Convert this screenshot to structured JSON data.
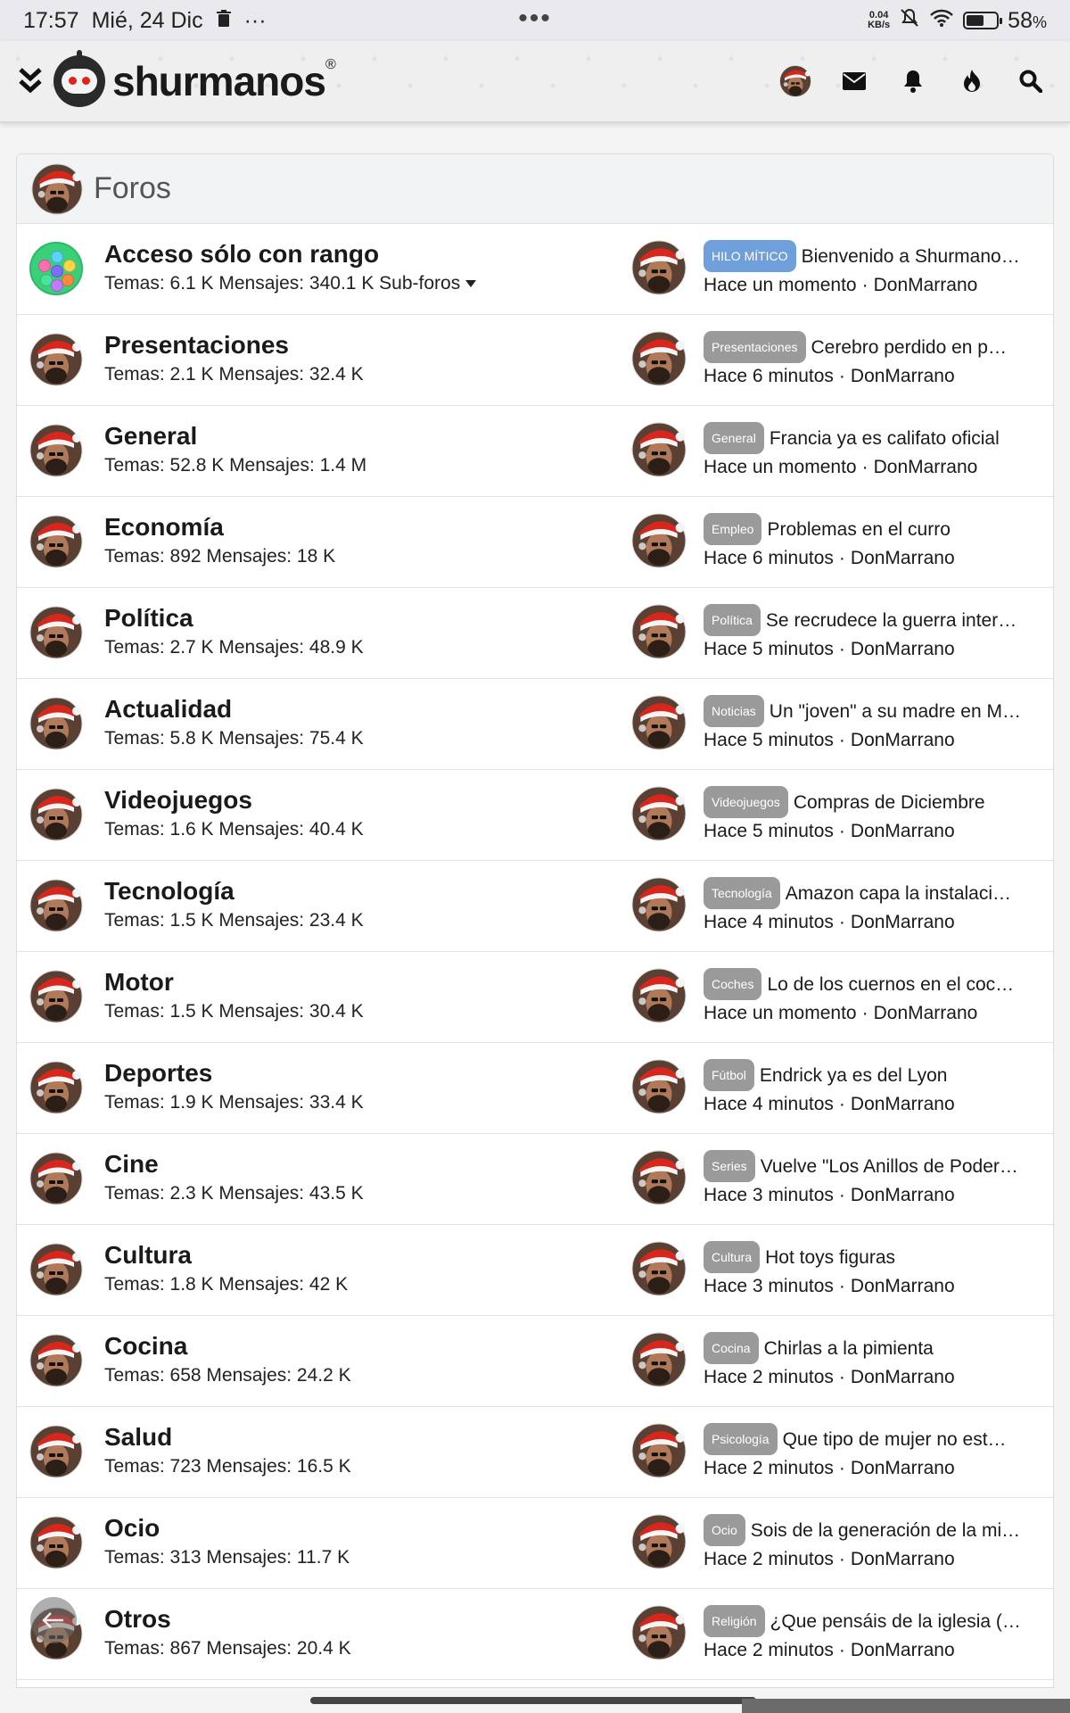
{
  "status_bar": {
    "time": "17:57",
    "date": "Mié, 24 Dic",
    "more": "···",
    "center_dots": "•••",
    "net_speed_top": "0.04",
    "net_speed_bottom": "KB/s",
    "battery": "58",
    "battery_unit": "%",
    "battery_level": 0.58
  },
  "header": {
    "logo_text": "shurmanos",
    "logo_mark": "®",
    "icons": [
      "menu-chevron-icon",
      "avatar",
      "mail-icon",
      "bell-icon",
      "fire-icon",
      "search-icon"
    ]
  },
  "section": {
    "title": "Foros"
  },
  "forums": [
    {
      "name": "Acceso sólo con rango",
      "stats": "Temas: 6.1 K Mensajes: 340.1 K",
      "subforums": "Sub-foros",
      "icon": "gems",
      "tag": "HILO MÍTICO",
      "tag_special": true,
      "last_title": "Bienvenido a Shurmano…",
      "last_time": "Hace un momento",
      "last_user": "DonMarrano"
    },
    {
      "name": "Presentaciones",
      "stats": "Temas: 2.1 K Mensajes: 32.4 K",
      "tag": "Presentaciones",
      "last_title": "Cerebro perdido en p…",
      "last_time": "Hace 6 minutos",
      "last_user": "DonMarrano"
    },
    {
      "name": "General",
      "stats": "Temas: 52.8 K Mensajes: 1.4 M",
      "tag": "General",
      "last_title": "Francia ya es califato oficial",
      "last_time": "Hace un momento",
      "last_user": "DonMarrano"
    },
    {
      "name": "Economía",
      "stats": "Temas: 892 Mensajes: 18 K",
      "tag": "Empleo",
      "last_title": "Problemas en el curro",
      "last_time": "Hace 6 minutos",
      "last_user": "DonMarrano"
    },
    {
      "name": "Política",
      "stats": "Temas: 2.7 K Mensajes: 48.9 K",
      "tag": "Política",
      "last_title": "Se recrudece la guerra inter…",
      "last_time": "Hace 5 minutos",
      "last_user": "DonMarrano"
    },
    {
      "name": "Actualidad",
      "stats": "Temas: 5.8 K Mensajes: 75.4 K",
      "tag": "Noticias",
      "last_title": "Un \"joven\" a su madre en M…",
      "last_time": "Hace 5 minutos",
      "last_user": "DonMarrano"
    },
    {
      "name": "Videojuegos",
      "stats": "Temas: 1.6 K Mensajes: 40.4 K",
      "tag": "Videojuegos",
      "last_title": "Compras de Diciembre",
      "last_time": "Hace 5 minutos",
      "last_user": "DonMarrano"
    },
    {
      "name": "Tecnología",
      "stats": "Temas: 1.5 K Mensajes: 23.4 K",
      "tag": "Tecnología",
      "last_title": "Amazon capa la instalaci…",
      "last_time": "Hace 4 minutos",
      "last_user": "DonMarrano"
    },
    {
      "name": "Motor",
      "stats": "Temas: 1.5 K Mensajes: 30.4 K",
      "tag": "Coches",
      "last_title": "Lo de los cuernos en el coc…",
      "last_time": "Hace un momento",
      "last_user": "DonMarrano"
    },
    {
      "name": "Deportes",
      "stats": "Temas: 1.9 K Mensajes: 33.4 K",
      "tag": "Fútbol",
      "last_title": "Endrick ya es del Lyon",
      "last_time": "Hace 4 minutos",
      "last_user": "DonMarrano"
    },
    {
      "name": "Cine",
      "stats": "Temas: 2.3 K Mensajes: 43.5 K",
      "tag": "Series",
      "last_title": "Vuelve \"Los Anillos de Poder…",
      "last_time": "Hace 3 minutos",
      "last_user": "DonMarrano"
    },
    {
      "name": "Cultura",
      "stats": "Temas: 1.8 K Mensajes: 42 K",
      "tag": "Cultura",
      "last_title": "Hot toys figuras",
      "last_time": "Hace 3 minutos",
      "last_user": "DonMarrano"
    },
    {
      "name": "Cocina",
      "stats": "Temas: 658 Mensajes: 24.2 K",
      "tag": "Cocina",
      "last_title": "Chirlas a la pimienta",
      "last_time": "Hace 2 minutos",
      "last_user": "DonMarrano"
    },
    {
      "name": "Salud",
      "stats": "Temas: 723 Mensajes: 16.5 K",
      "tag": "Psicología",
      "last_title": "Que tipo de mujer no est…",
      "last_time": "Hace 2 minutos",
      "last_user": "DonMarrano"
    },
    {
      "name": "Ocio",
      "stats": "Temas: 313 Mensajes: 11.7 K",
      "tag": "Ocio",
      "last_title": "Sois de la generación de la mi…",
      "last_time": "Hace 2 minutos",
      "last_user": "DonMarrano"
    },
    {
      "name": "Otros",
      "stats": "Temas: 867 Mensajes: 20.4 K",
      "tag": "Religión",
      "last_title": "¿Que pensáis de la iglesia (…",
      "last_time": "Hace 2 minutos",
      "last_user": "DonMarrano"
    }
  ],
  "separator": "·",
  "colors": {
    "tag_default": "#9a9a9a",
    "tag_special": "#6fa0dc",
    "header_bg": "#efefef",
    "card_head_bg": "#f1f3f5"
  }
}
